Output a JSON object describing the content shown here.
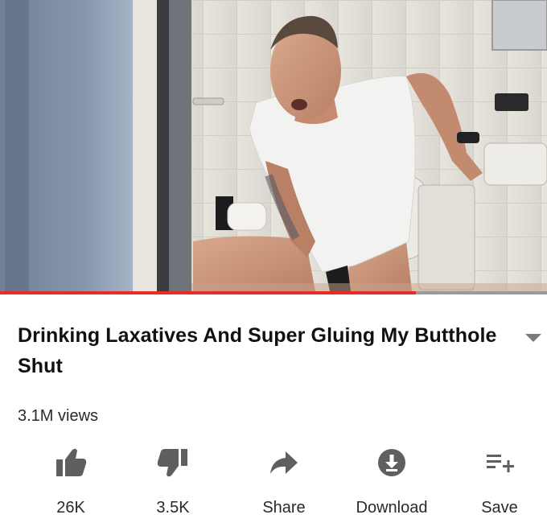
{
  "video": {
    "progress_fraction": 0.76
  },
  "video_info": {
    "title": "Drinking Laxatives And Super Gluing My Butthole Shut",
    "views": "3.1M views"
  },
  "actions": [
    {
      "id": "like",
      "label": "26K",
      "icon": "thumbs-up-icon"
    },
    {
      "id": "dislike",
      "label": "3.5K",
      "icon": "thumbs-down-icon"
    },
    {
      "id": "share",
      "label": "Share",
      "icon": "share-arrow-icon"
    },
    {
      "id": "download",
      "label": "Download",
      "icon": "download-icon"
    },
    {
      "id": "save",
      "label": "Save",
      "icon": "add-to-playlist-icon"
    }
  ],
  "colors": {
    "progress": "#e52d27",
    "icons": "#5f5f5f"
  }
}
